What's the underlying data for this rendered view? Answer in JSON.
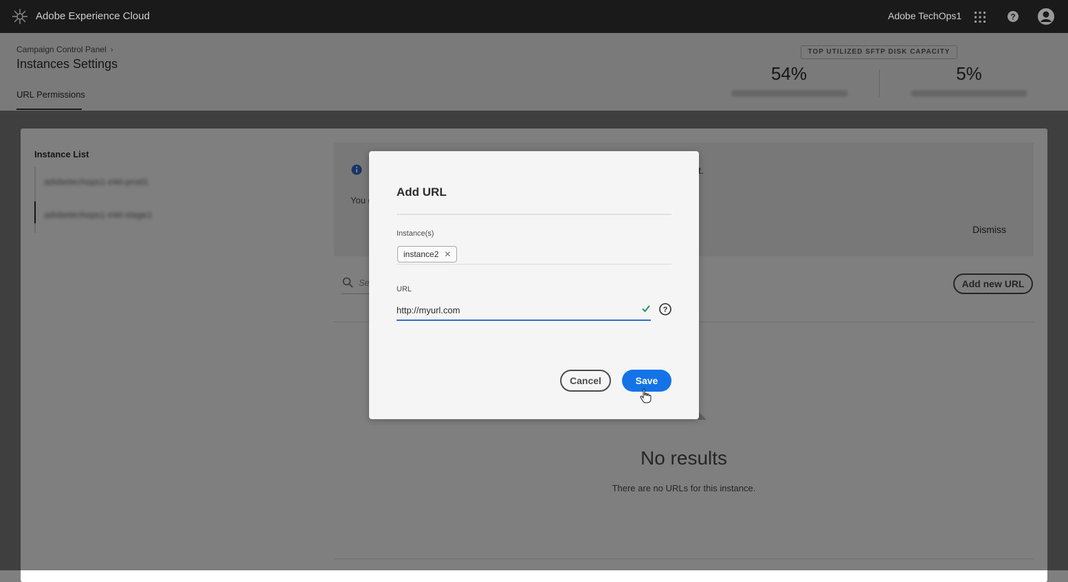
{
  "shell": {
    "brand": "Adobe Experience Cloud",
    "org": "Adobe TechOps1",
    "icons": [
      "adobe-logo-icon",
      "apps-grid-icon",
      "help-icon",
      "user-avatar-icon"
    ]
  },
  "header": {
    "breadcrumb": "Campaign Control Panel",
    "title": "Instances Settings",
    "tab": "URL Permissions",
    "capacity": {
      "label": "TOP UTILIZED SFTP DISK CAPACITY",
      "values": [
        "54%",
        "5%"
      ]
    }
  },
  "instances": {
    "heading": "Instance List",
    "items": [
      "adobetechops1-mkt-prod1",
      "adobetechops1-mkt-stage1"
    ]
  },
  "notice": {
    "tail": "t.",
    "body": "You c",
    "dismiss": "Dismiss"
  },
  "toolbar": {
    "search_placeholder": "Se",
    "add_url": "Add new URL"
  },
  "empty": {
    "title": "No results",
    "message": "There are no URLs for this instance."
  },
  "dialog": {
    "title": "Add URL",
    "instances_label": "Instance(s)",
    "instance_tag": "instance2",
    "url_label": "URL",
    "url_value": "http://myurl.com",
    "cancel": "Cancel",
    "save": "Save"
  },
  "colors": {
    "shell": "#1a1a1a",
    "accent": "#1473e6",
    "valid": "#268e6c"
  }
}
